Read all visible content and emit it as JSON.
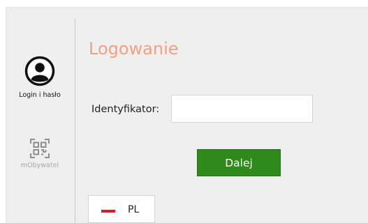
{
  "sidebar": {
    "methods": [
      {
        "label": "Login i hasło",
        "icon": "user-circle-icon"
      },
      {
        "label": "mObywatel",
        "icon": "qr-code-icon"
      }
    ]
  },
  "main": {
    "title": "Logowanie",
    "identifier_label": "Identyfikator:",
    "identifier_value": "",
    "submit_label": "Dalej"
  },
  "language": {
    "code": "PL"
  },
  "colors": {
    "title": "#f4a080",
    "button": "#2f8a1b",
    "flag_red": "#e01b1b"
  }
}
